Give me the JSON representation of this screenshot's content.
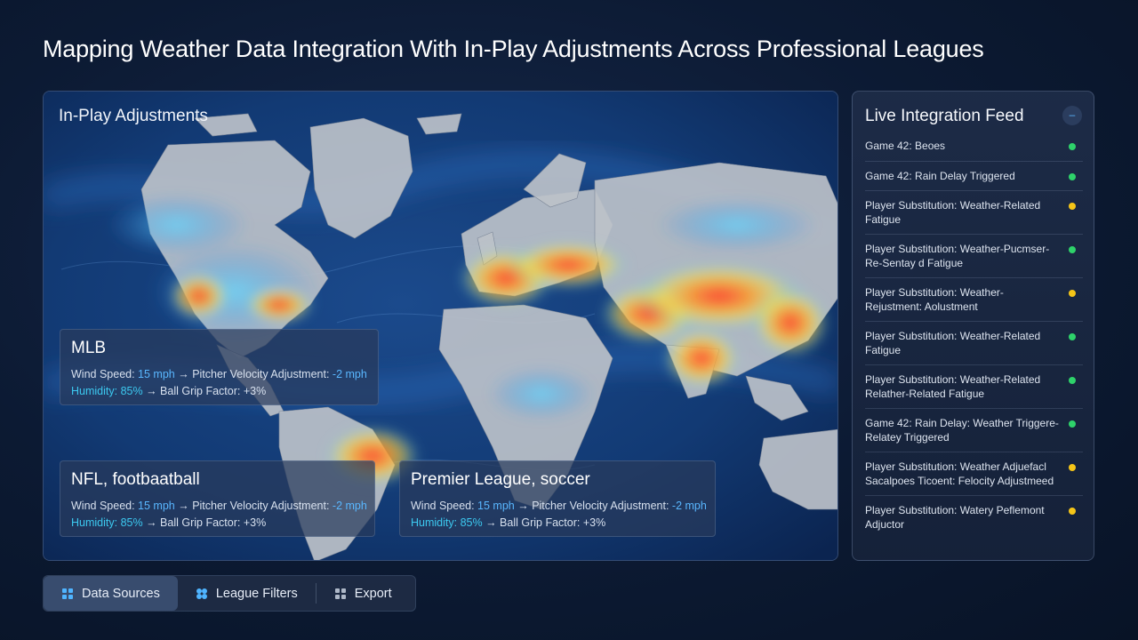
{
  "title": "Mapping Weather Data Integration With In-Play Adjustments Across Professional Leagues",
  "map_panel": {
    "header": "In-Play Adjustments",
    "cards": [
      {
        "name": "MLB",
        "line1_label": "Wind Speed: ",
        "line1_value": "15 mph",
        "line1_arrow": " → Pitcher Velocity Adjustment: ",
        "line1_adj": "-2 mph",
        "line2_label": "Humidity: 85%",
        "line2_arrow": " → Ball Grip Factor: +3%"
      },
      {
        "name": "NFL, footbaatball",
        "line1_label": "Wind Speed: ",
        "line1_value": "15 mph",
        "line1_arrow": " → Pitcher Velocity Adjustment: ",
        "line1_adj": "-2 mph",
        "line2_label": "Humidity: 85%",
        "line2_arrow": " → Ball Grip Factor: +3%"
      },
      {
        "name": "Premier League, soccer",
        "line1_label": "Wind Speed: ",
        "line1_value": "15 mph",
        "line1_arrow": " → Pitcher Velocity Adjustment: ",
        "line1_adj": "-2 mph",
        "line2_label": "Humidity: 85%",
        "line2_arrow": " → Ball Grip Factor: +3%"
      }
    ]
  },
  "feed": {
    "title": "Live Integration Feed",
    "toggle_symbol": "–",
    "items": [
      {
        "text": "Game 42: Beoes",
        "status": "green"
      },
      {
        "text": "Game 42: Rain Delay Triggered",
        "status": "green"
      },
      {
        "text": "Player Substitution: Weather-Related Fatigue",
        "status": "yellow"
      },
      {
        "text": "Player Substitution: Weather-Pucmser-Re-Sentay d Fatigue",
        "status": "green"
      },
      {
        "text": "Player Substitution: Weather-Rejustment: Aolustment",
        "status": "yellow"
      },
      {
        "text": "Player Substitution: Weather-Related Fatigue",
        "status": "green"
      },
      {
        "text": "Player Substitution: Weather-Related Relather-Related Fatigue",
        "status": "green"
      },
      {
        "text": "Game 42: Rain Delay: Weather Triggere-Relatey Triggered",
        "status": "green"
      },
      {
        "text": "Player Substitution: Weather Adjuefacl Sacalpoes Ticoent: Felocity Adjustmeed",
        "status": "yellow"
      },
      {
        "text": "Player Substitution: Watery Peflemont Adjuctor",
        "status": "yellow"
      }
    ]
  },
  "toolbar": {
    "data_sources": "Data Sources",
    "league_filters": "League Filters",
    "export": "Export"
  },
  "colors": {
    "accent_blue": "#59b7ff",
    "status_green": "#2ed26a",
    "status_yellow": "#f5c518"
  }
}
